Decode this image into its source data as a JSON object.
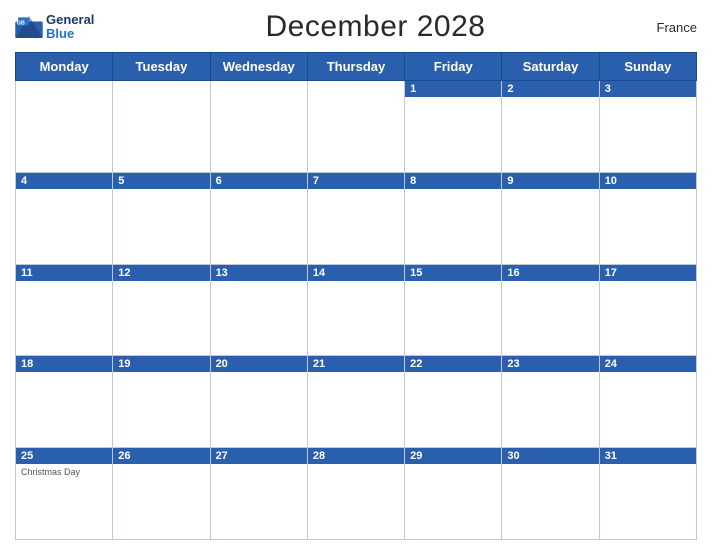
{
  "header": {
    "title": "December 2028",
    "country": "France",
    "logo_general": "General",
    "logo_blue": "Blue"
  },
  "days_of_week": [
    "Monday",
    "Tuesday",
    "Wednesday",
    "Thursday",
    "Friday",
    "Saturday",
    "Sunday"
  ],
  "weeks": [
    {
      "dates": [
        "",
        "",
        "",
        "",
        "1",
        "2",
        "3"
      ],
      "events": {
        "5": ""
      }
    },
    {
      "dates": [
        "4",
        "5",
        "6",
        "7",
        "8",
        "9",
        "10"
      ],
      "events": {}
    },
    {
      "dates": [
        "11",
        "12",
        "13",
        "14",
        "15",
        "16",
        "17"
      ],
      "events": {}
    },
    {
      "dates": [
        "18",
        "19",
        "20",
        "21",
        "22",
        "23",
        "24"
      ],
      "events": {}
    },
    {
      "dates": [
        "25",
        "26",
        "27",
        "28",
        "29",
        "30",
        "31"
      ],
      "events": {
        "25": "Christmas Day"
      }
    }
  ],
  "colors": {
    "header_bg": "#2a5fad",
    "header_text": "#ffffff",
    "border": "#c0c8d8",
    "day_number": "#1a3a6b"
  }
}
